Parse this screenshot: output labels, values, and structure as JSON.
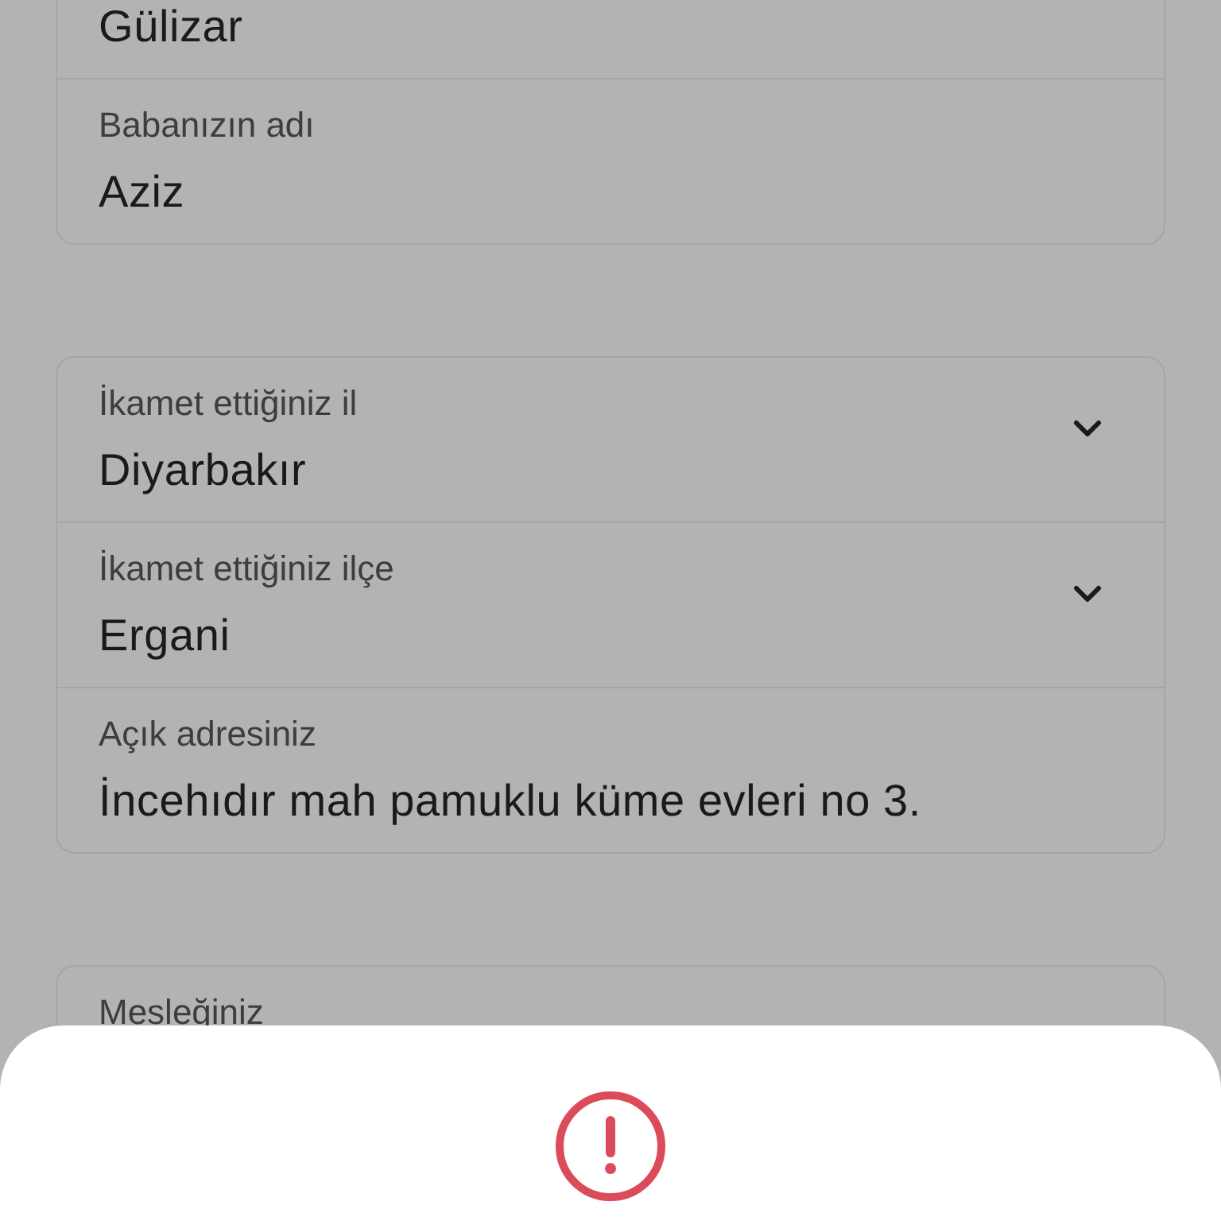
{
  "groups": [
    {
      "fields": [
        {
          "kind": "text",
          "value": "Gülizar"
        },
        {
          "kind": "text",
          "label": "Babanızın adı",
          "value": "Aziz"
        }
      ]
    },
    {
      "fields": [
        {
          "kind": "select",
          "label": "İkamet ettiğiniz il",
          "value": "Diyarbakır"
        },
        {
          "kind": "select",
          "label": "İkamet ettiğiniz ilçe",
          "value": "Ergani"
        },
        {
          "kind": "text",
          "label": "Açık adresiniz",
          "value": "İncehıdır mah pamuklu küme evleri no 3."
        }
      ]
    },
    {
      "fields": [
        {
          "kind": "text",
          "label": "Mesleğiniz"
        }
      ]
    }
  ]
}
